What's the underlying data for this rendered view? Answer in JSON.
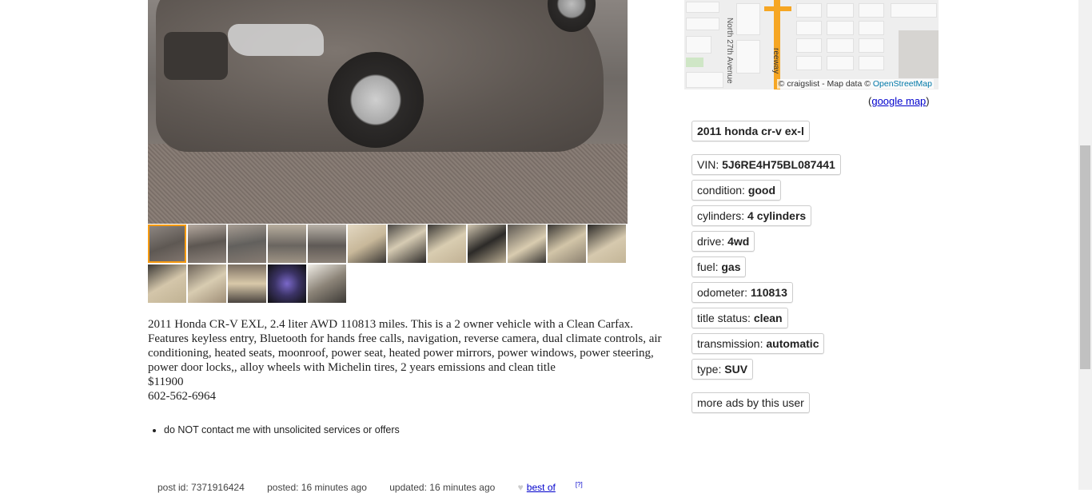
{
  "gallery": {
    "main_image_alt": "Brown 2011 Honda CR-V front view",
    "thumbnails_row1": [
      "thumb-1",
      "thumb-2",
      "thumb-3",
      "thumb-4",
      "thumb-5",
      "thumb-6",
      "thumb-7",
      "thumb-8",
      "thumb-9",
      "thumb-10",
      "thumb-11",
      "thumb-12"
    ],
    "thumbnails_row2": [
      "thumb-13",
      "thumb-14",
      "thumb-15",
      "thumb-16",
      "thumb-17"
    ]
  },
  "description": {
    "body": "2011 Honda CR-V EXL, 2.4 liter AWD 110813 miles. This is a 2 owner vehicle with a Clean Carfax. Features keyless entry, Bluetooth for hands free calls, navigation, reverse camera, dual climate controls, air conditioning, heated seats, moonroof, power seat, heated power mirrors, power windows, power steering, power door locks,, alloy wheels with Michelin tires, 2 years emissions and clean title\n$11900\n602-562-6964"
  },
  "notices": [
    "do NOT contact me with unsolicited services or offers"
  ],
  "postinfo": {
    "post_id": "post id: 7371916424",
    "posted": "posted: 16 minutes ago",
    "updated": "updated: 16 minutes ago",
    "best_of": "best of",
    "best_of_sup": "[?]"
  },
  "map": {
    "street_label": "North 27th Avenue",
    "freeway_label": "reeway",
    "attribution_prefix": "© craigslist - Map data © ",
    "attribution_link": "OpenStreetMap",
    "google_map_open": "(",
    "google_map_link": "google map",
    "google_map_close": ")"
  },
  "attributes": {
    "title": "2011 honda cr-v ex-l",
    "vin_label": "VIN: ",
    "vin_value": "5J6RE4H75BL087441",
    "condition_label": "condition: ",
    "condition_value": "good",
    "cylinders_label": "cylinders: ",
    "cylinders_value": "4 cylinders",
    "drive_label": "drive: ",
    "drive_value": "4wd",
    "fuel_label": "fuel: ",
    "fuel_value": "gas",
    "odometer_label": "odometer: ",
    "odometer_value": "110813",
    "title_status_label": "title status: ",
    "title_status_value": "clean",
    "transmission_label": "transmission: ",
    "transmission_value": "automatic",
    "type_label": "type: ",
    "type_value": "SUV"
  },
  "more_ads": "more ads by this user",
  "colors": {
    "selected_thumb": "#f59a11",
    "link": "#0000cc",
    "freeway": "#f6a623"
  }
}
